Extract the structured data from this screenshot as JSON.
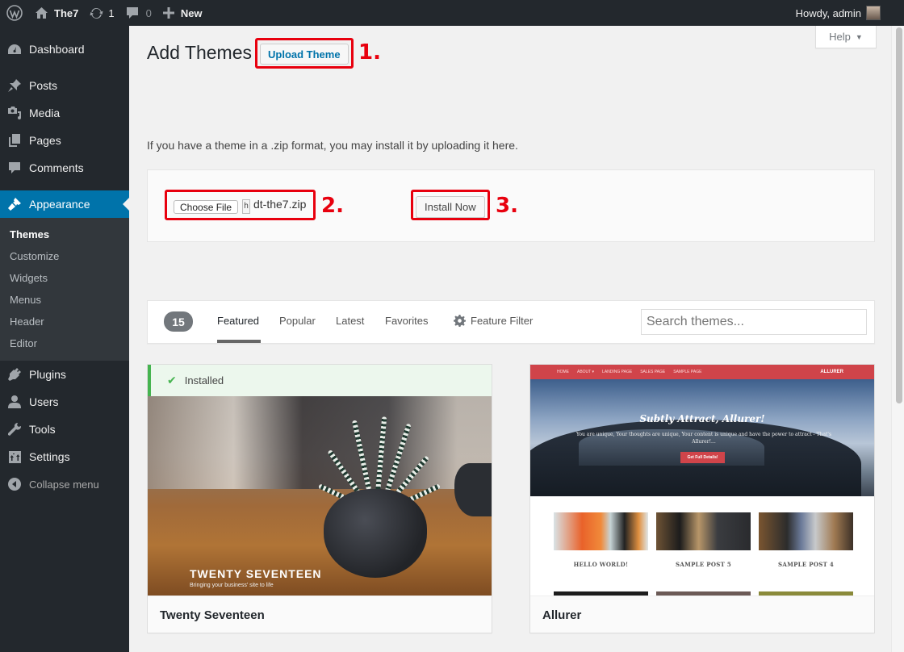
{
  "adminbar": {
    "site_name": "The7",
    "updates_count": "1",
    "comments_count": "0",
    "new_label": "New",
    "greeting": "Howdy, admin"
  },
  "sidebar": {
    "items": [
      {
        "label": "Dashboard",
        "icon": "dashboard-icon"
      },
      {
        "label": "Posts",
        "icon": "pin-icon"
      },
      {
        "label": "Media",
        "icon": "media-icon"
      },
      {
        "label": "Pages",
        "icon": "pages-icon"
      },
      {
        "label": "Comments",
        "icon": "comment-icon"
      },
      {
        "label": "Appearance",
        "icon": "brush-icon",
        "active": true
      },
      {
        "label": "Plugins",
        "icon": "plug-icon"
      },
      {
        "label": "Users",
        "icon": "user-icon"
      },
      {
        "label": "Tools",
        "icon": "wrench-icon"
      },
      {
        "label": "Settings",
        "icon": "settings-icon"
      }
    ],
    "appearance_submenu": [
      "Themes",
      "Customize",
      "Widgets",
      "Menus",
      "Header",
      "Editor"
    ],
    "collapse_label": "Collapse menu"
  },
  "help": {
    "label": "Help"
  },
  "page": {
    "title": "Add Themes",
    "upload_button": "Upload Theme",
    "upload_description": "If you have a theme in a .zip format, you may install it by uploading it here.",
    "choose_file_button": "Choose File",
    "file_glyph": "h",
    "selected_file": "dt-the7.zip",
    "install_button": "Install Now"
  },
  "annotations": {
    "step1": "1.",
    "step2": "2.",
    "step3": "3.",
    "color": "#e8000e"
  },
  "filter_bar": {
    "count": "15",
    "tabs": [
      "Featured",
      "Popular",
      "Latest",
      "Favorites"
    ],
    "current_tab": "Featured",
    "feature_filter": "Feature Filter",
    "search_placeholder": "Search themes..."
  },
  "themes": [
    {
      "name": "Twenty Seventeen",
      "installed_label": "Installed",
      "screenshot_title": "TWENTY SEVENTEEN",
      "screenshot_tagline": "Bringing your business' site to life"
    },
    {
      "name": "Allurer",
      "screenshot_nav": [
        "HOME",
        "ABOUT ▾",
        "LANDING PAGE",
        "SALES PAGE",
        "SAMPLE PAGE"
      ],
      "screenshot_brand": "ALLURER",
      "screenshot_heading": "Subtly Attract, Allurer!",
      "screenshot_subheading": "You are unique, Your thoughts are unique, Your content is unique and have the power to attract - That's Allurer!...",
      "screenshot_cta": "Get Full Details!",
      "screenshot_posts": [
        "HELLO WORLD!",
        "SAMPLE POST 5",
        "SAMPLE POST 4"
      ]
    }
  ],
  "colors": {
    "adminbar_bg": "#23282d",
    "accent": "#0073aa",
    "installed_green": "#46b450",
    "allurer_red": "#d0444a"
  }
}
